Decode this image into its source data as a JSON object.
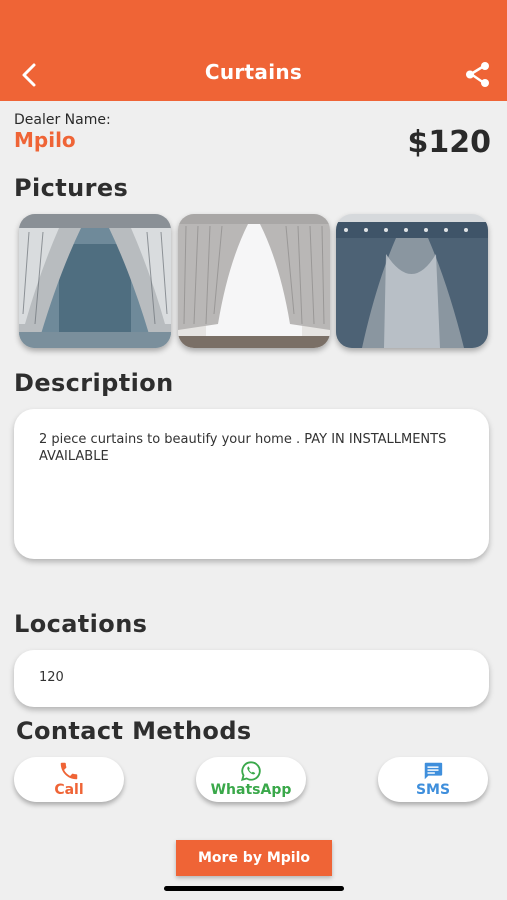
{
  "header": {
    "title": "Curtains",
    "back_icon": "chevron-left-icon",
    "share_icon": "share-icon",
    "background_color": "#ef6436"
  },
  "dealer": {
    "label": "Dealer Name:",
    "name": "Mpilo"
  },
  "price": "$120",
  "pictures": {
    "title": "Pictures"
  },
  "description": {
    "title": "Description",
    "text": "2 piece curtains to beautify your home . PAY IN INSTALLMENTS AVAILABLE"
  },
  "locations": {
    "title": "Locations",
    "value": "120"
  },
  "contact": {
    "title": "Contact Methods",
    "methods": [
      {
        "label": "Call",
        "icon": "phone-icon",
        "color": "#ef6436"
      },
      {
        "label": "WhatsApp",
        "icon": "whatsapp-icon",
        "color": "#3aa84a"
      },
      {
        "label": "SMS",
        "icon": "sms-icon",
        "color": "#3f8fdc"
      }
    ]
  },
  "more_button": {
    "label": "More by Mpilo"
  }
}
